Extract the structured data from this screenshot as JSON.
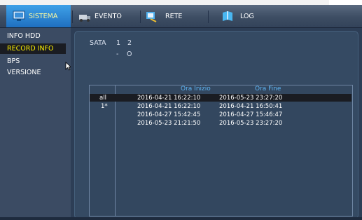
{
  "tabs": [
    {
      "label": "SISTEMA",
      "icon": "system-monitor-icon",
      "active": true
    },
    {
      "label": "EVENTO",
      "icon": "event-truck-icon",
      "active": false
    },
    {
      "label": "RETE",
      "icon": "network-icon",
      "active": false
    },
    {
      "label": "LOG",
      "icon": "log-book-icon",
      "active": false
    }
  ],
  "sidebar": {
    "items": [
      {
        "label": "INFO HDD",
        "active": false
      },
      {
        "label": "RECORD INFO",
        "active": true
      },
      {
        "label": "BPS",
        "active": false
      },
      {
        "label": "VERSIONE",
        "active": false
      }
    ]
  },
  "sata": {
    "label": "SATA",
    "columns": [
      "1",
      "2"
    ],
    "status": [
      "-",
      "O"
    ]
  },
  "table": {
    "headers": [
      "Ora Inizio",
      "Ora Fine"
    ],
    "rows": [
      {
        "index": "all",
        "start": "2016-04-21 16:22:10",
        "end": "2016-05-23 23:27:20"
      },
      {
        "index": "1*",
        "start": "2016-04-21 16:22:10",
        "end": "2016-04-21 16:50:41"
      },
      {
        "index": "",
        "start": "2016-04-27 15:42:45",
        "end": "2016-04-27 15:46:47"
      },
      {
        "index": "",
        "start": "2016-05-23 21:21:50",
        "end": "2016-05-23 23:27:20"
      }
    ]
  },
  "colors": {
    "active_tab": "#2a86d6",
    "active_sidebar_text": "#fff200",
    "header_text": "#5fb4f2",
    "background": "#2d3e56"
  }
}
